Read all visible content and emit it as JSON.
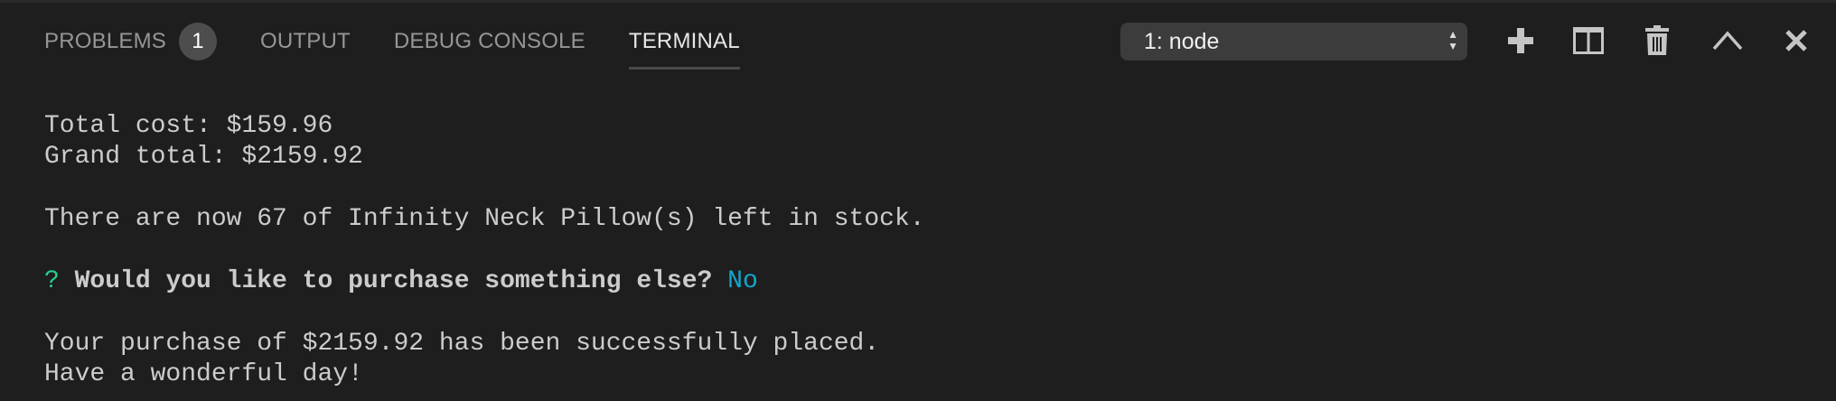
{
  "panel": {
    "tabs": [
      {
        "label": "PROBLEMS",
        "badge": "1"
      },
      {
        "label": "OUTPUT"
      },
      {
        "label": "DEBUG CONSOLE"
      },
      {
        "label": "TERMINAL",
        "active": true
      }
    ],
    "terminal_select": {
      "value": "1: node"
    },
    "actions": [
      "plus-icon",
      "split-icon",
      "trash-icon",
      "chevron-up-icon",
      "close-icon"
    ]
  },
  "terminal": {
    "lines": [
      "Total cost: $159.96",
      "Grand total: $2159.92",
      "",
      "There are now 67 of Infinity Neck Pillow(s) left in stock.",
      ""
    ],
    "prompt": {
      "marker": "?",
      "question": "Would you like to purchase something else?",
      "answer": "No"
    },
    "after": [
      "",
      "Your purchase of $2159.92 has been successfully placed.",
      "Have a wonderful day!"
    ]
  },
  "colors": {
    "background": "#1e1e1e",
    "text": "#cccccc",
    "prompt_marker": "#23d18b",
    "answer": "#11a8cd"
  }
}
